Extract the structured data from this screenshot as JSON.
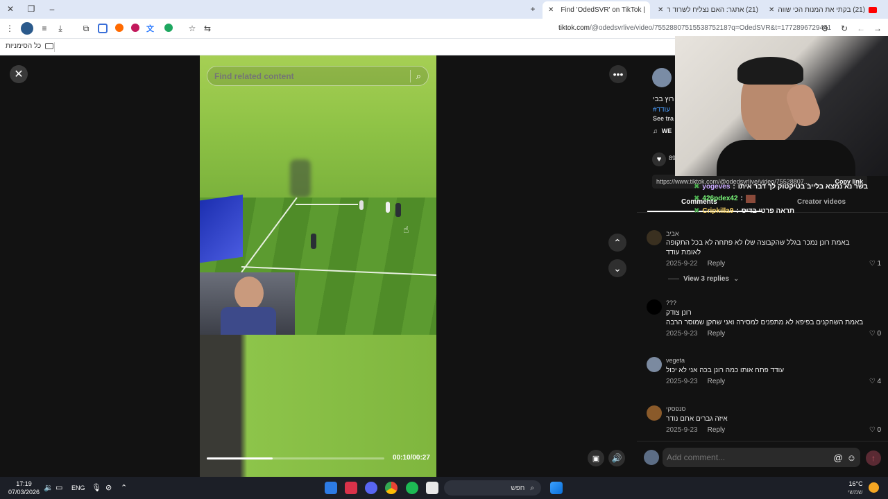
{
  "browser": {
    "tabs": [
      {
        "label": "(21) בקתי את המנות הכי שווה",
        "icon": "youtube-icon"
      },
      {
        "label": "(21) אתגר: האם נצליח לשרוד ר",
        "icon": "youtube-icon"
      },
      {
        "label": "Find 'OdedSVR' on TikTok |",
        "icon": "tiktok-icon"
      }
    ],
    "url_host": "tiktok.com",
    "url_path": "/@odedsvrlive/video/7552880751553875218?q=OdedSVR&t=1772896729441",
    "bookmarks_label": "כל הסימניות"
  },
  "player": {
    "search_placeholder": "Find related content",
    "time_current": "00:10",
    "time_total": "00:27",
    "time_display": "00:10/00:27",
    "progress": 0.37
  },
  "creator": {
    "caption_line": "רוץ בבי",
    "hashtag": "#עודד",
    "see_translation": "See tra",
    "music": "WE",
    "likes": "89",
    "link": "https://www.tiktok.com/@odedsvrlive/video/75528807...",
    "copy_link": "Copy link"
  },
  "tabs_panel": {
    "comments": "Comments",
    "creator_videos": "Creator videos"
  },
  "chat_overlay": [
    {
      "user": "yogeves",
      "text": "בשר נא נמצא בלייב בטיקטוק לך דבר איתו"
    },
    {
      "user": "426pdex42",
      "text": ""
    },
    {
      "user": "Cripkilla9",
      "text": "תראה פרטי בדיס"
    }
  ],
  "comments": [
    {
      "user": "אביב",
      "lines": [
        "באמת רונן נמכר בגלל שהקבוצה שלו לא פתחה לא בכל התקופה",
        "לאומת עודד"
      ],
      "date": "2025-9-22",
      "reply": "Reply",
      "likes": "1",
      "view_replies": "View 3 replies"
    },
    {
      "user": "???",
      "lines": [
        "רונן צודק",
        "באמת השחקנים בפיפא לא מתפנים למסירה ואני שחקן שמוסר הרבה"
      ],
      "date": "2025-9-23",
      "reply": "Reply",
      "likes": "0"
    },
    {
      "user": "vegeta",
      "lines": [
        "עודד פתח אותו כמה רונן בכה אני לא יכול"
      ],
      "date": "2025-9-23",
      "reply": "Reply",
      "likes": "4"
    },
    {
      "user": "סנפסקי",
      "lines": [
        "איזה גברים אתם נודר"
      ],
      "date": "2025-9-23",
      "reply": "Reply",
      "likes": "0"
    }
  ],
  "comment_input": {
    "placeholder": "Add comment..."
  },
  "taskbar": {
    "time": "17:19",
    "date": "07/03/2026",
    "lang": "ENG",
    "search_label": "חפש",
    "weather_temp": "16°C",
    "weather_label": "שמשי"
  },
  "colors": {
    "accent_red": "#fe2c55",
    "tiktok_bg": "#121212",
    "chrome_tab_bg": "#dfe7f6"
  }
}
